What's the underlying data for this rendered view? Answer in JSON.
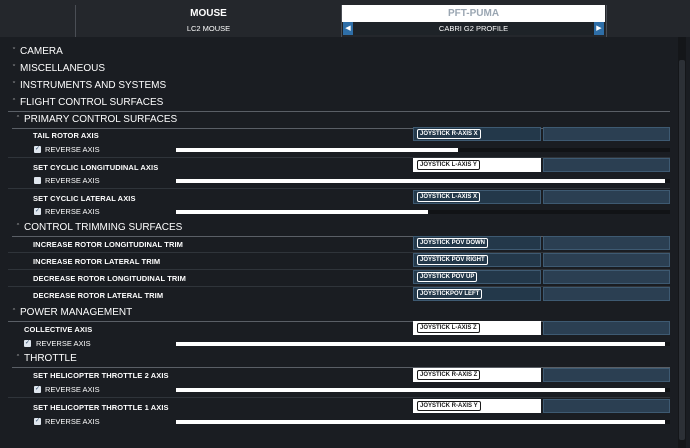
{
  "header": {
    "left_title": "MOUSE",
    "left_sub": "LC2 MOUSE",
    "right_title": "PFT-PUMA",
    "right_sub": "CABRI G2 PROFILE",
    "prev_icon": "chevron-left-icon",
    "next_icon": "chevron-right-icon"
  },
  "categories": {
    "camera": "CAMERA",
    "misc": "MISCELLANEOUS",
    "instruments": "INSTRUMENTS AND SYSTEMS",
    "flight_control": "FLIGHT CONTROL SURFACES",
    "primary": "PRIMARY CONTROL SURFACES",
    "trimming": "CONTROL TRIMMING SURFACES",
    "power": "POWER MANAGEMENT",
    "throttle": "THROTTLE"
  },
  "reverse_label": "REVERSE AXIS",
  "rows": {
    "tail_rotor": {
      "label": "TAIL ROTOR AXIS",
      "binding": "JOYSTICK R-AXIS X",
      "reverse": true,
      "level": 0.57
    },
    "cyclic_long": {
      "label": "SET CYCLIC LONGITUDINAL AXIS",
      "binding": "JOYSTICK L-AXIS Y",
      "reverse": false,
      "level": 0.99
    },
    "cyclic_lat": {
      "label": "SET CYCLIC LATERAL AXIS",
      "binding": "JOYSTICK L-AXIS X",
      "reverse": true,
      "level": 0.51
    },
    "trim_long_inc": {
      "label": "INCREASE ROTOR LONGITUDINAL TRIM",
      "binding": "JOYSTICK POV DOWN"
    },
    "trim_lat_inc": {
      "label": "INCREASE ROTOR LATERAL TRIM",
      "binding": "JOYSTICK POV RIGHT"
    },
    "trim_long_dec": {
      "label": "DECREASE ROTOR LONGITUDINAL TRIM",
      "binding": "JOYSTICK POV UP"
    },
    "trim_lat_dec": {
      "label": "DECREASE ROTOR LATERAL TRIM",
      "binding": "JOYSTICKPOV LEFT"
    },
    "collective": {
      "label": "COLLECTIVE AXIS",
      "binding": "JOYSTICK L-AXIS Z",
      "reverse": true,
      "level": 0.99
    },
    "throttle2": {
      "label": "SET HELICOPTER THROTTLE 2 AXIS",
      "binding": "JOYSTICK R-AXIS Z",
      "reverse": true,
      "level": 0.99
    },
    "throttle1": {
      "label": "SET HELICOPTER THROTTLE 1 AXIS",
      "binding": "JOYSTICK R-AXIS Y",
      "reverse": true,
      "level": 0.99
    }
  },
  "colors": {
    "accent": "#2e6ea7",
    "binding_bg": "#23384a",
    "background": "#1a1d22"
  }
}
